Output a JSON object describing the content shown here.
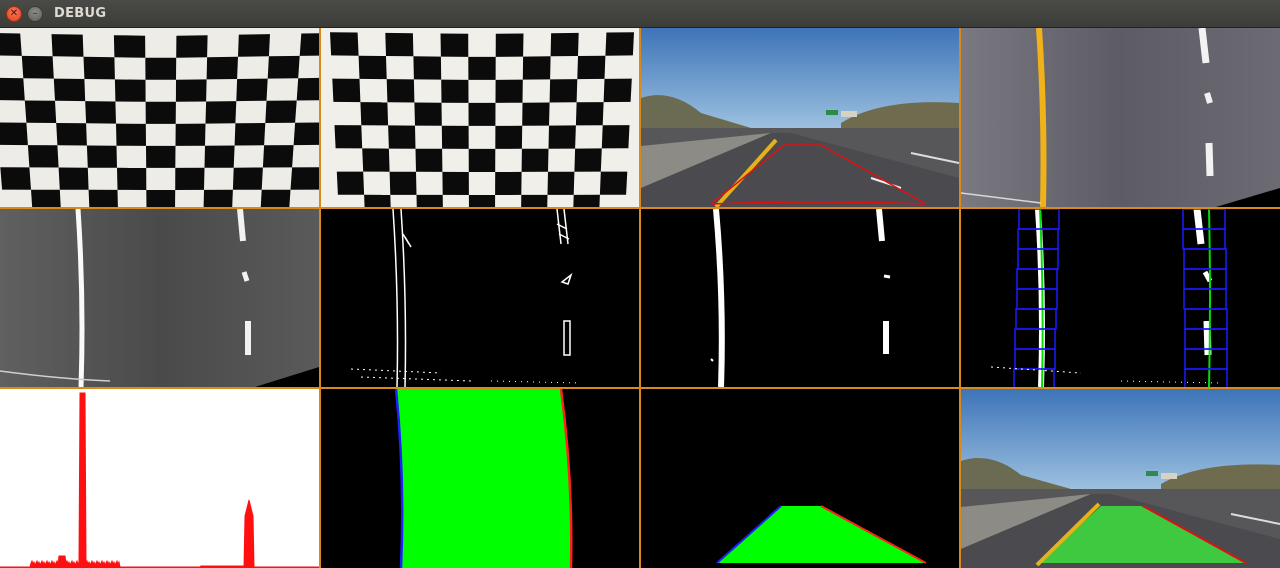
{
  "window": {
    "title": "DEBUG",
    "close_icon": "close-icon",
    "minimize_icon": "minimize-icon"
  },
  "panels": [
    {
      "name": "calibration-chessboard-original"
    },
    {
      "name": "calibration-chessboard-undistorted"
    },
    {
      "name": "road-frame-perspective-region"
    },
    {
      "name": "birds-eye-road-color"
    },
    {
      "name": "birds-eye-grayscale"
    },
    {
      "name": "binary-threshold-edges"
    },
    {
      "name": "binary-threshold-combined"
    },
    {
      "name": "sliding-window-lane-search"
    },
    {
      "name": "lane-pixel-histogram"
    },
    {
      "name": "lane-fill-birds-eye"
    },
    {
      "name": "lane-fill-warped-back"
    },
    {
      "name": "final-lane-overlay"
    }
  ],
  "colors": {
    "panel_border": "#d98a1a",
    "lane_fill": "#00ff00",
    "lane_left_edge": "#0000ff",
    "lane_right_edge": "#ff0000",
    "search_window": "#0000ff",
    "histogram": "#ff0000"
  }
}
